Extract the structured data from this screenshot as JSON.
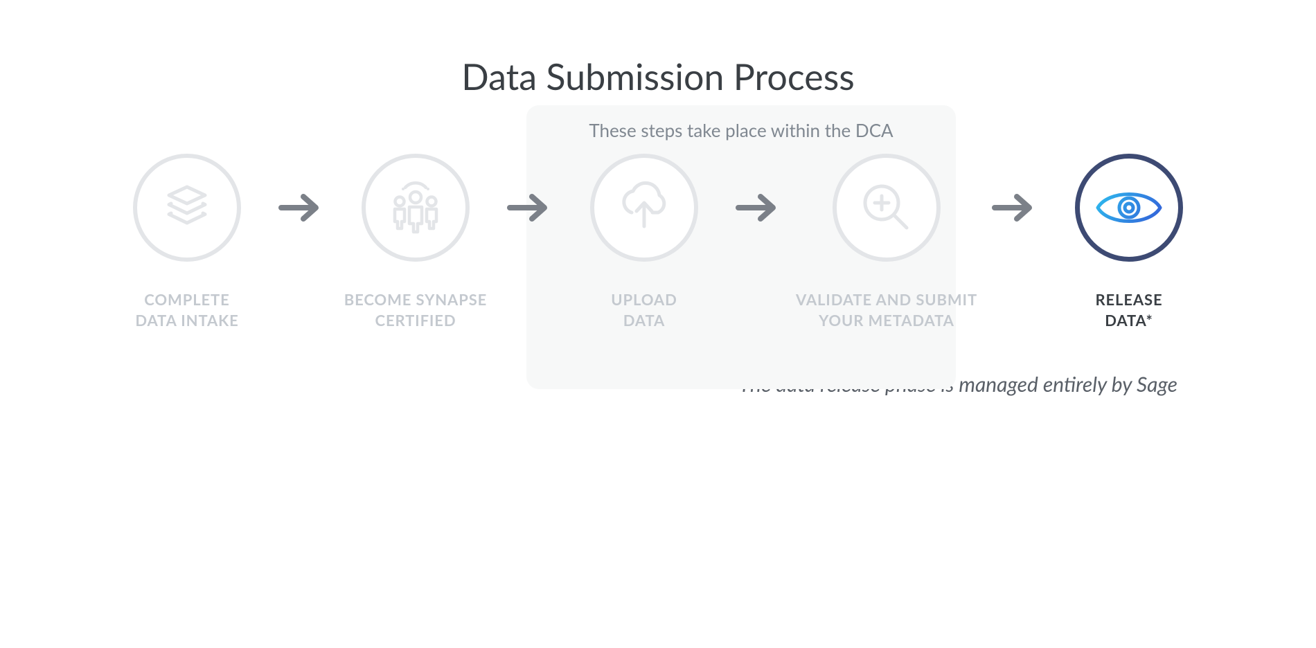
{
  "title": "Data Submission Process",
  "dca_caption": "These steps take place within the DCA",
  "footnote": "*The data release phase is managed entirely by Sage",
  "steps": [
    {
      "label_line1": "COMPLETE",
      "label_line2": "DATA INTAKE",
      "active": false
    },
    {
      "label_line1": "BECOME SYNAPSE",
      "label_line2": "CERTIFIED",
      "active": false
    },
    {
      "label_line1": "UPLOAD",
      "label_line2": "DATA",
      "active": false
    },
    {
      "label_line1": "VALIDATE AND SUBMIT",
      "label_line2": "YOUR METADATA",
      "active": false
    },
    {
      "label_line1": "RELEASE",
      "label_line2": "DATA*",
      "active": true
    }
  ],
  "colors": {
    "inactive_stroke": "#e3e5e8",
    "inactive_text": "#c4c9cf",
    "arrow": "#7b8088",
    "active_ring": "#3d4a73",
    "active_text": "#3a3f44",
    "eye_cyan": "#2dc4f0",
    "eye_blue": "#3456d6"
  }
}
